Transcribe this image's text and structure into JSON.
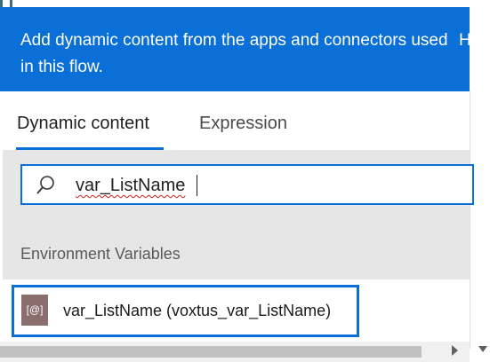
{
  "header": {
    "message": "Add dynamic content from the apps and connectors used in this flow.",
    "help_letter": "H"
  },
  "tabs": [
    {
      "label": "Dynamic content",
      "active": true
    },
    {
      "label": "Expression",
      "active": false
    }
  ],
  "search": {
    "value": "var_ListName",
    "icon": "search-icon"
  },
  "section": {
    "title": "Environment Variables"
  },
  "items": [
    {
      "icon_text": "[@]",
      "label": "var_ListName (voxtus_var_ListName)",
      "icon": "environment-variable-icon"
    }
  ],
  "colors": {
    "accent": "#0a6fd6",
    "item_icon_bg": "#8a6d6d",
    "section_bg": "#e6e6e6"
  }
}
